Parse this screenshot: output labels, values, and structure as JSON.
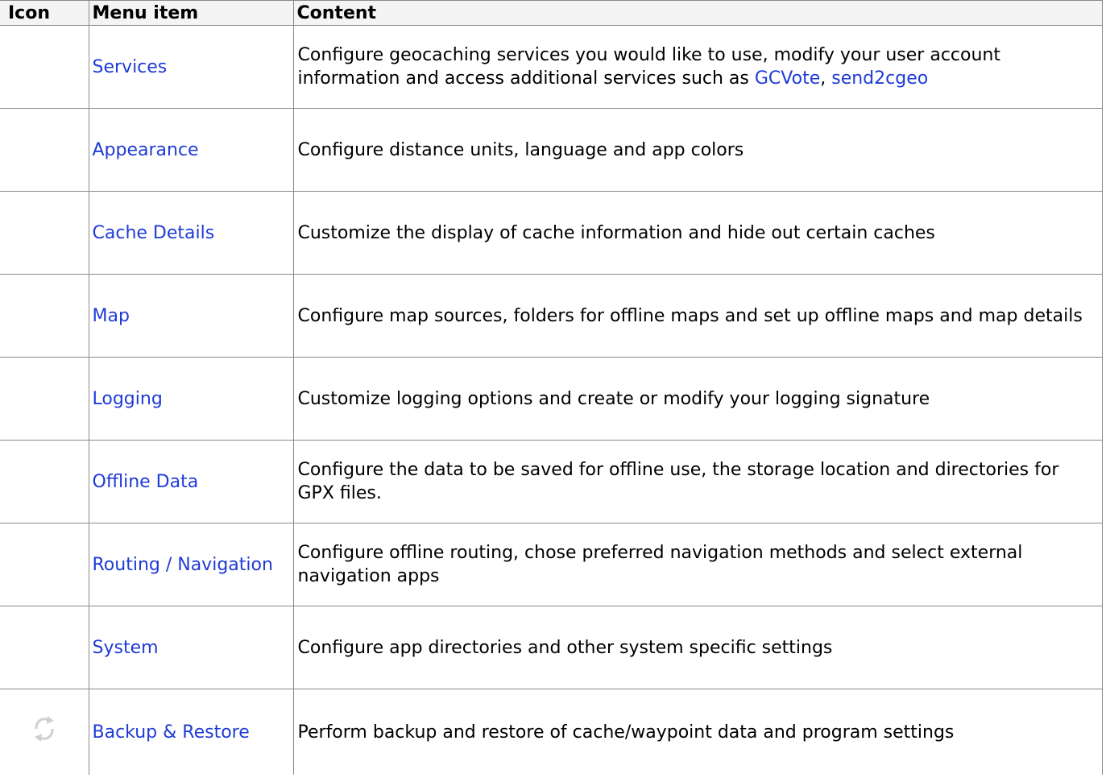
{
  "headers": {
    "icon": "Icon",
    "menu_item": "Menu item",
    "content": "Content"
  },
  "rows": [
    {
      "menu_item": "Services",
      "content": "Configure geocaching services you would like to use, modify your user account information and access additional services such as ",
      "link_1": "GCVote",
      "separator": ", ",
      "link_2": "send2cgeo"
    },
    {
      "menu_item": "Appearance",
      "content": "Configure distance units, language and app colors"
    },
    {
      "menu_item": "Cache Details",
      "content": "Customize the display of cache information and hide out certain caches"
    },
    {
      "menu_item": "Map",
      "content": "Configure map sources, folders for offline maps and set up offline maps and map details"
    },
    {
      "menu_item": "Logging",
      "content": "Customize logging options and create or modify your logging signature"
    },
    {
      "menu_item": "Offline Data",
      "content": "Configure the data to be saved for offline use, the storage location and directories for GPX files."
    },
    {
      "menu_item": "Routing / Navigation",
      "content": "Configure offline routing, chose preferred navigation methods and select external navigation apps"
    },
    {
      "menu_item": "System",
      "content": "Configure app directories and other system specific settings"
    },
    {
      "menu_item": "Backup & Restore",
      "content": "Perform backup and restore of cache/waypoint data and program settings",
      "icon": "sync-arrows-icon"
    }
  ],
  "colors": {
    "link": "#1f3bd6",
    "border": "#8a8a8a",
    "icon": "#d0d0d0"
  }
}
